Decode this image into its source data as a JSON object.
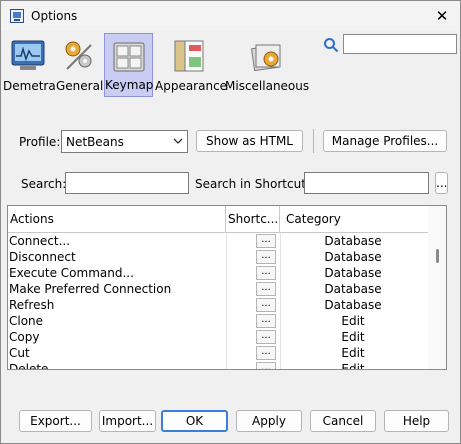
{
  "window": {
    "title": "Options",
    "close_glyph": "✕"
  },
  "categories": [
    {
      "label": "Demetra",
      "icon": "demetra-icon"
    },
    {
      "label": "General",
      "icon": "gears-icon"
    },
    {
      "label": "Keymap",
      "icon": "keyboard-icon",
      "selected": true
    },
    {
      "label": "Appearance",
      "icon": "appearance-icon"
    },
    {
      "label": "Miscellaneous",
      "icon": "miscellaneous-icon"
    }
  ],
  "search": {
    "value": ""
  },
  "profile": {
    "label": "Profile:",
    "selected": "NetBeans",
    "show_html": "Show as HTML",
    "manage": "Manage Profiles..."
  },
  "filters": {
    "search_label": "Search:",
    "search_value": "",
    "shortcuts_label": "Search in Shortcuts:",
    "shortcuts_value": "",
    "shortcuts_button": "..."
  },
  "table": {
    "columns": [
      "Actions",
      "Shortc...",
      "Category"
    ],
    "rows": [
      {
        "action": "Connect...",
        "shortcut": "...",
        "category": "Database"
      },
      {
        "action": "Disconnect",
        "shortcut": "...",
        "category": "Database"
      },
      {
        "action": "Execute Command...",
        "shortcut": "...",
        "category": "Database"
      },
      {
        "action": "Make Preferred Connection",
        "shortcut": "...",
        "category": "Database"
      },
      {
        "action": "Refresh",
        "shortcut": "...",
        "category": "Database"
      },
      {
        "action": "Clone",
        "shortcut": "...",
        "category": "Edit"
      },
      {
        "action": "Copy",
        "shortcut": "...",
        "category": "Edit"
      },
      {
        "action": "Cut",
        "shortcut": "...",
        "category": "Edit"
      },
      {
        "action": "Delete",
        "shortcut": "...",
        "category": "Edit"
      }
    ]
  },
  "footer": {
    "export": "Export...",
    "import": "Import...",
    "ok": "OK",
    "apply": "Apply",
    "cancel": "Cancel",
    "help": "Help"
  },
  "colors": {
    "selected_bg": "#c9cdf2",
    "default_button_border": "#3c7fd8"
  }
}
